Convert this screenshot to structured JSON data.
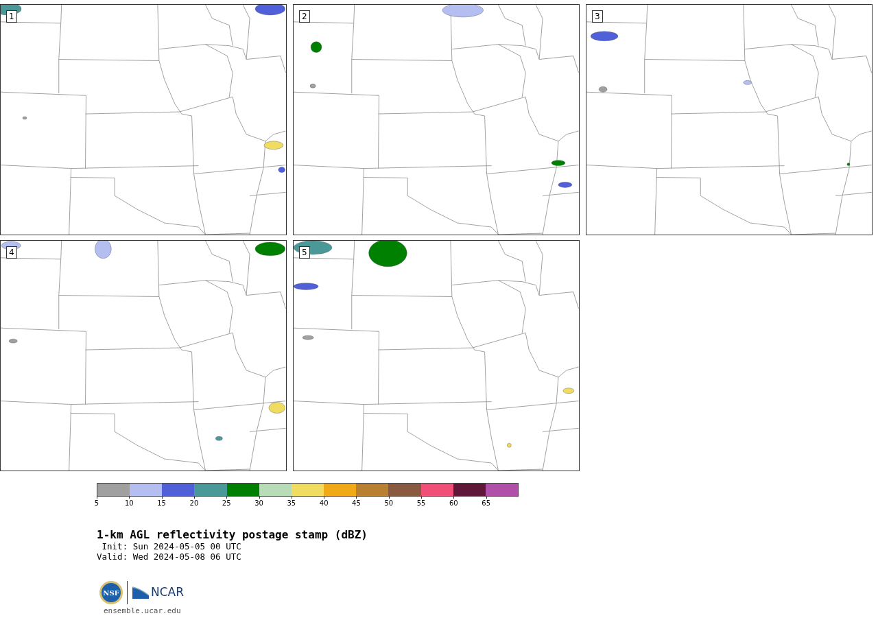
{
  "panels": [
    {
      "label": "1"
    },
    {
      "label": "2"
    },
    {
      "label": "3"
    },
    {
      "label": "4"
    },
    {
      "label": "5"
    }
  ],
  "colorbar": {
    "bins": [
      {
        "color": "#a0a0a0"
      },
      {
        "color": "#b4bef0"
      },
      {
        "color": "#5060d8"
      },
      {
        "color": "#4a9898"
      },
      {
        "color": "#008000"
      },
      {
        "color": "#b8dcb8"
      },
      {
        "color": "#f0dc60"
      },
      {
        "color": "#f0aa18"
      },
      {
        "color": "#b88030"
      },
      {
        "color": "#8a5a40"
      },
      {
        "color": "#f05078"
      },
      {
        "color": "#601838"
      },
      {
        "color": "#b050a8"
      }
    ],
    "ticks": [
      "5",
      "10",
      "15",
      "20",
      "25",
      "30",
      "35",
      "40",
      "45",
      "50",
      "55",
      "60",
      "65"
    ]
  },
  "title": "1-km AGL reflectivity postage stamp (dBZ)",
  "init": " Init: Sun 2024-05-05 00 UTC",
  "valid": "Valid: Wed 2024-05-08 06 UTC",
  "logos": {
    "nsf": "NSF",
    "ncar": "NCAR"
  },
  "url": "ensemble.ucar.edu"
}
